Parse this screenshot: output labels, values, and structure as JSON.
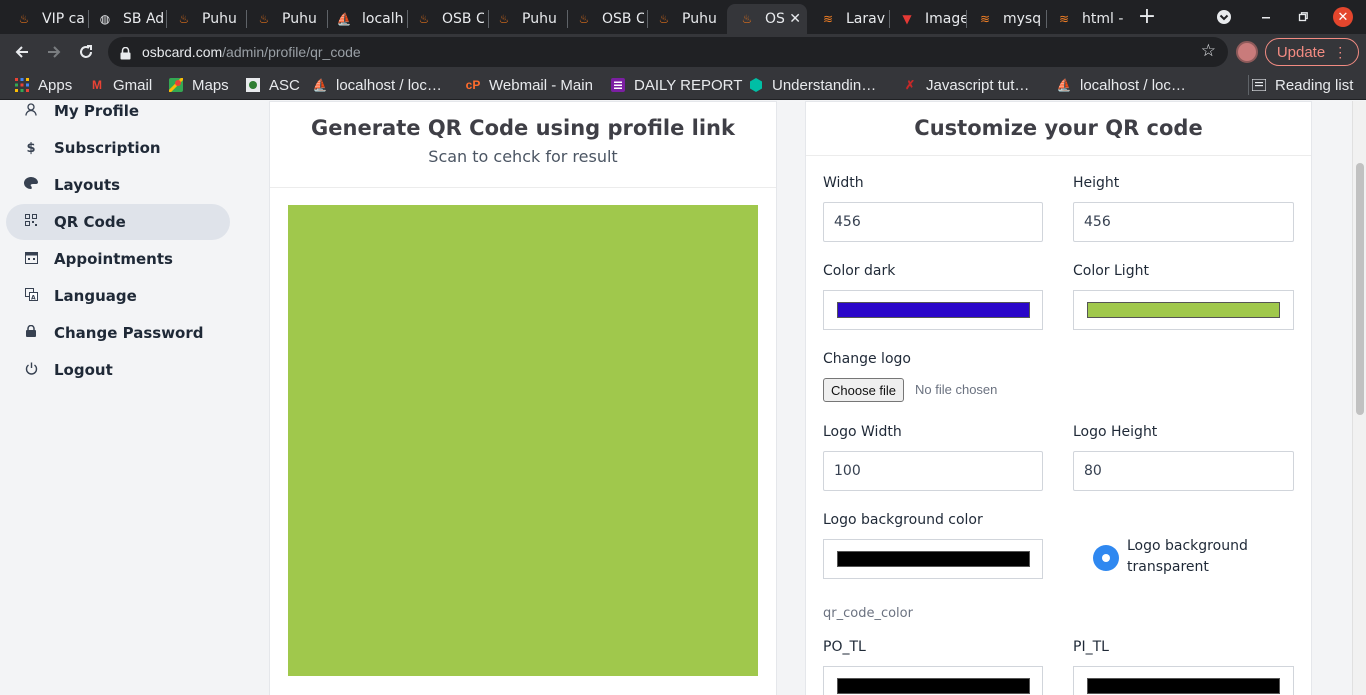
{
  "browser": {
    "tabs": [
      {
        "label": "VIP ca",
        "icon": "flame-icon"
      },
      {
        "label": "SB Ad",
        "icon": "globe-icon"
      },
      {
        "label": "Puhu",
        "icon": "flame-icon"
      },
      {
        "label": "Puhu",
        "icon": "flame-icon"
      },
      {
        "label": "localh",
        "icon": "sail-icon"
      },
      {
        "label": "OSB C",
        "icon": "flame-icon"
      },
      {
        "label": "Puhu",
        "icon": "flame-icon"
      },
      {
        "label": "OSB C",
        "icon": "flame-icon"
      },
      {
        "label": "Puhu",
        "icon": "flame-icon"
      },
      {
        "label": "OS",
        "icon": "flame-icon",
        "active": true
      },
      {
        "label": "Larav",
        "icon": "stack-icon"
      },
      {
        "label": "Image",
        "icon": "v-icon"
      },
      {
        "label": "mysq",
        "icon": "stack-icon"
      },
      {
        "label": "html -",
        "icon": "stack-icon"
      }
    ],
    "close_tab": "✕",
    "new_tab": "+",
    "url_domain": "osbcard.com",
    "url_path": "/admin/profile/qr_code",
    "update_label": "Update",
    "bookmarks": [
      {
        "label": "Apps",
        "icon": "apps-grid-icon"
      },
      {
        "label": "Gmail",
        "icon": "gmail-icon"
      },
      {
        "label": "Maps",
        "icon": "maps-icon"
      },
      {
        "label": "ASC",
        "icon": "asc-icon"
      },
      {
        "label": "localhost / loc…",
        "icon": "sail-icon"
      },
      {
        "label": "Webmail - Main",
        "icon": "cpanel-icon"
      },
      {
        "label": "DAILY REPORT",
        "icon": "list-icon"
      },
      {
        "label": "Understandin…",
        "icon": "hexagon-icon"
      },
      {
        "label": "Javascript tut…",
        "icon": "x-icon"
      },
      {
        "label": "localhost / loc…",
        "icon": "sail-icon"
      }
    ],
    "reading_list": "Reading list"
  },
  "sidebar": {
    "items": [
      {
        "label": "My Profile",
        "icon": "user-icon"
      },
      {
        "label": "Subscription",
        "icon": "dollar-icon"
      },
      {
        "label": "Layouts",
        "icon": "palette-icon"
      },
      {
        "label": "QR Code",
        "icon": "qrcode-icon",
        "active": true
      },
      {
        "label": "Appointments",
        "icon": "calendar-icon"
      },
      {
        "label": "Language",
        "icon": "language-icon"
      },
      {
        "label": "Change Password",
        "icon": "lock-icon"
      },
      {
        "label": "Logout",
        "icon": "power-icon"
      }
    ]
  },
  "generator": {
    "title": "Generate QR Code using profile link",
    "subtitle": "Scan to cehck for result",
    "preview_color": "#a0c84c"
  },
  "customize": {
    "title": "Customize your QR code",
    "width_label": "Width",
    "width_value": "456",
    "height_label": "Height",
    "height_value": "456",
    "color_dark_label": "Color dark",
    "color_dark": "#2a06c9",
    "color_light_label": "Color Light",
    "color_light": "#a0c84c",
    "change_logo_label": "Change logo",
    "choose_file_label": "Choose file",
    "file_status": "No file chosen",
    "logo_width_label": "Logo Width",
    "logo_width_value": "100",
    "logo_height_label": "Logo Height",
    "logo_height_value": "80",
    "logo_bg_color_label": "Logo background color",
    "logo_bg_color": "#000000",
    "logo_bg_transparent_label": "Logo background transparent",
    "section_note": "qr_code_color",
    "po_tl_label": "PO_TL",
    "po_tl_color": "#000000",
    "pi_tl_label": "PI_TL",
    "pi_tl_color": "#000000"
  }
}
